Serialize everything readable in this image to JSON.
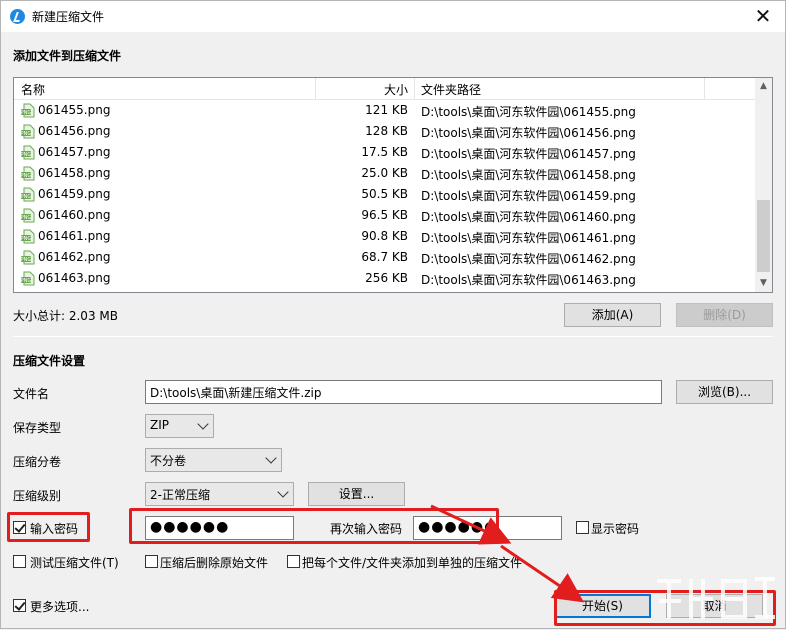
{
  "window": {
    "title": "新建压缩文件",
    "close_symbol": "✕"
  },
  "add_section": {
    "title": "添加文件到压缩文件"
  },
  "file_list": {
    "columns": {
      "name": "名称",
      "size": "大小",
      "path": "文件夹路径"
    },
    "rows": [
      {
        "name": "061455.png",
        "size": "121 KB",
        "path": "D:\\tools\\桌面\\河东软件园\\061455.png"
      },
      {
        "name": "061456.png",
        "size": "128 KB",
        "path": "D:\\tools\\桌面\\河东软件园\\061456.png"
      },
      {
        "name": "061457.png",
        "size": "17.5 KB",
        "path": "D:\\tools\\桌面\\河东软件园\\061457.png"
      },
      {
        "name": "061458.png",
        "size": "25.0 KB",
        "path": "D:\\tools\\桌面\\河东软件园\\061458.png"
      },
      {
        "name": "061459.png",
        "size": "50.5 KB",
        "path": "D:\\tools\\桌面\\河东软件园\\061459.png"
      },
      {
        "name": "061460.png",
        "size": "96.5 KB",
        "path": "D:\\tools\\桌面\\河东软件园\\061460.png"
      },
      {
        "name": "061461.png",
        "size": "90.8 KB",
        "path": "D:\\tools\\桌面\\河东软件园\\061461.png"
      },
      {
        "name": "061462.png",
        "size": "68.7 KB",
        "path": "D:\\tools\\桌面\\河东软件园\\061462.png"
      },
      {
        "name": "061463.png",
        "size": "256 KB",
        "path": "D:\\tools\\桌面\\河东软件园\\061463.png"
      }
    ],
    "total_size": "大小总计: 2.03 MB",
    "add_button": "添加(A)",
    "delete_button": "删除(D)"
  },
  "settings": {
    "title": "压缩文件设置",
    "filename_label": "文件名",
    "filename_value": "D:\\tools\\桌面\\新建压缩文件.zip",
    "browse_button": "浏览(B)...",
    "save_type_label": "保存类型",
    "save_type_value": "ZIP",
    "split_label": "压缩分卷",
    "split_value": "不分卷",
    "level_label": "压缩级别",
    "level_value": "2-正常压缩",
    "level_settings_button": "设置...",
    "password_checkbox_label": "输入密码",
    "password_value": "●●●●●●",
    "confirm_label": "再次输入密码",
    "confirm_value": "●●●●●●",
    "show_password_label": "显示密码",
    "test_label": "测试压缩文件(T)",
    "delete_after_label": "压缩后删除原始文件",
    "separate_label": "把每个文件/文件夹添加到单独的压缩文件",
    "more_options_label": "更多选项...",
    "start_button": "开始(S)",
    "cancel_button": "取消"
  },
  "colors": {
    "annotation_red": "#e11d1d",
    "accent_blue": "#0078d7"
  }
}
